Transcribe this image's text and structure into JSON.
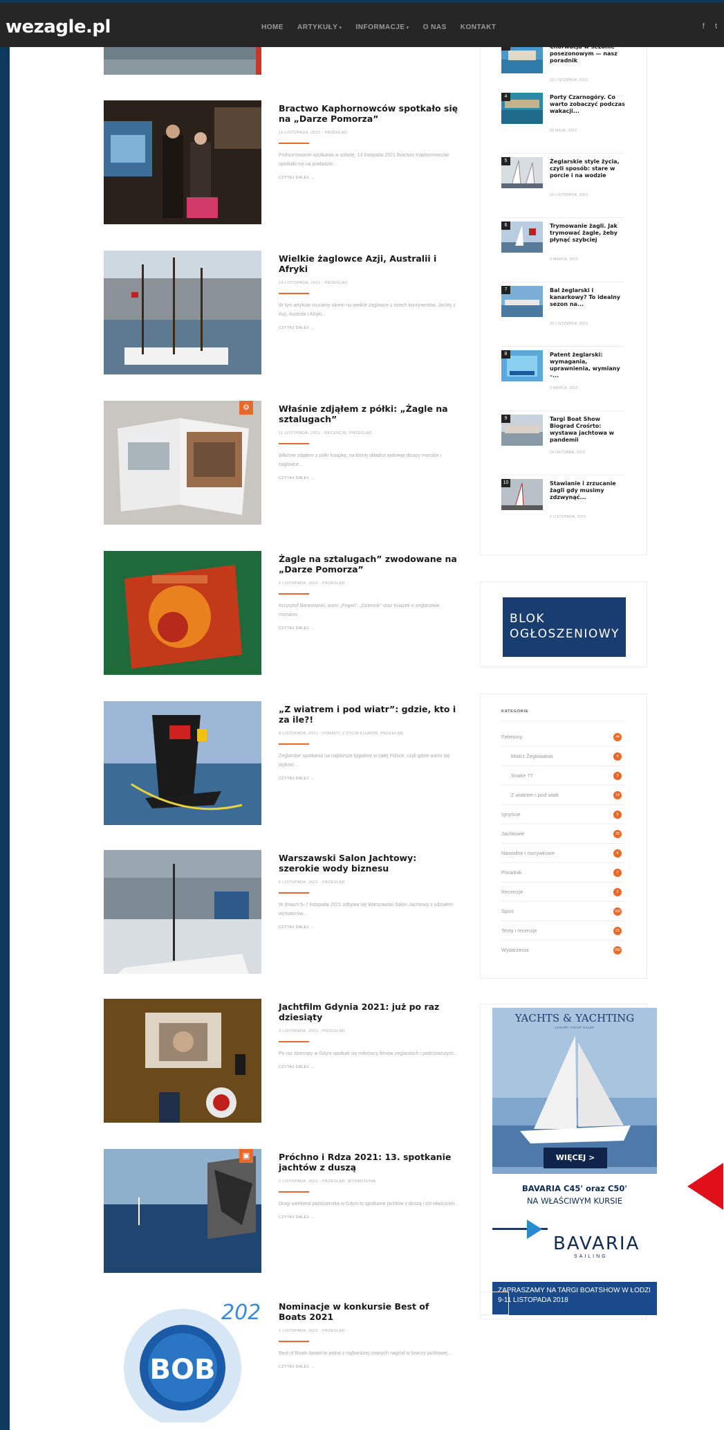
{
  "header": {
    "logo": "wezagle.pl",
    "nav": [
      {
        "label": "HOME",
        "active": true,
        "dropdown": false
      },
      {
        "label": "ARTYKUŁY",
        "active": false,
        "dropdown": true
      },
      {
        "label": "INFORMACJE",
        "active": false,
        "dropdown": true
      },
      {
        "label": "O NAS",
        "active": false,
        "dropdown": false
      },
      {
        "label": "KONTAKT",
        "active": false,
        "dropdown": false
      }
    ],
    "social": "f  t"
  },
  "posts": [
    {
      "title": "Bractwo Kaphornowców spotkało się na „Darze Pomorza”",
      "meta": "16 LISTOPADA, 2021  -  PRZEGLĄD",
      "excerpt": "Podsumowanie spotkania w sobotę, 13 listopada 2021 Bractwo Kaphornowców spotkało się na pokładzie...",
      "more": "CZYTAJ DALEJ  →"
    },
    {
      "title": "Wielkie żaglowce Azji, Australii i Afryki",
      "meta": "14 LISTOPADA, 2021  -  PRZEGLĄD",
      "excerpt": "W tym artykule rzucamy okiem na wielkie żaglowce z trzech kontynentów. Jachty z Azji, Australii i Afryki...",
      "more": "CZYTAJ DALEJ  →"
    },
    {
      "title": "Właśnie zdjąłem z półki: „Żagle na sztalugach”",
      "meta": "11 LISTOPADA, 2021  -  RECENZJE, PRZEGLĄD",
      "excerpt": "Właśnie zdjąłem z półki książkę, na której okładce widnieją obrazy morskie i żaglowce...",
      "more": "CZYTAJ DALEJ  →"
    },
    {
      "title": "Żagle na sztalugach” zwodowane na „Darze Pomorza”",
      "meta": "9 LISTOPADA, 2021  -  PRZEGLĄD",
      "excerpt": "Krzysztof Baranowski, autor „Pogoń”, „Dziennik” oraz książek o żeglarstwie morskim...",
      "more": "CZYTAJ DALEJ  →"
    },
    {
      "title": "„Z wiatrem i pod wiatr”: gdzie, kto i za ile?!",
      "meta": "8 LISTOPADA, 2021  -  PORADY, Z ŻYCIA KLUBÓW, PRZEGLĄD",
      "excerpt": "Żeglarskie spotkania na najbliższe tygodnie w całej Polsce, czyli gdzie warto się wybrać...",
      "more": "CZYTAJ DALEJ  →"
    },
    {
      "title": "Warszawski Salon Jachtowy: szerokie wody biznesu",
      "meta": "5 LISTOPADA, 2021  -  PRZEGLĄD",
      "excerpt": "W dniach 5–7 listopada 2021 odbywa się Warszawski Salon Jachtowy z udziałem wystawców...",
      "more": "CZYTAJ DALEJ  →"
    },
    {
      "title": "Jachtfilm Gdynia 2021: już po raz dziesiąty",
      "meta": "3 LISTOPADA, 2021  -  PRZEGLĄD",
      "excerpt": "Po raz dziesiąty w Gdyni spotkali się miłośnicy filmów żeglarskich i podróżniczych...",
      "more": "CZYTAJ DALEJ  →"
    },
    {
      "title": "Próchno i Rdza 2021: 13. spotkanie jachtów z duszą",
      "meta": "2 LISTOPADA, 2021  -  PRZEGLĄD, WYDARZENIA",
      "excerpt": "Drugi weekend października w Gdyni to spotkanie jachtów z duszą i ich właścicieli...",
      "more": "CZYTAJ DALEJ  →"
    },
    {
      "title": "Nominacje w konkursie Best of Boats 2021",
      "meta": "1 LISTOPADA, 2021  -  PRZEGLĄD",
      "excerpt": "Best of Boats Award to jedna z najbardziej znanych nagród w branży jachtowej...",
      "more": "CZYTAJ DALEJ  →"
    }
  ],
  "popular": [
    {
      "num": "3",
      "title": "Chorwacja w sezonie posezonowym — nasz poradnik",
      "date": "10 LISTOPADA, 2021"
    },
    {
      "num": "4",
      "title": "Porty Czarnogóry. Co warto zobaczyć podczas wakacji...",
      "date": "28 MAJA, 2021"
    },
    {
      "num": "5",
      "title": "Żeglarskie style życia, czyli sposób: stare w porcie i na wodzie",
      "date": "12 LISTOPADA, 2021"
    },
    {
      "num": "6",
      "title": "Trymowanie żagli. Jak trymować żagle, żeby płynąć szybciej",
      "date": "3 MARCA, 2021"
    },
    {
      "num": "7",
      "title": "Bal żeglarski i kanarkowy? To idealny sezon na...",
      "date": "20 LISTOPADA, 2021"
    },
    {
      "num": "8",
      "title": "Patent żeglarski: wymagania, uprawnienia, wymiany –...",
      "date": "3 MARCA, 2021"
    },
    {
      "num": "9",
      "title": "Targi Boat Show Biograd Crośrto: wystawa jachtowa w pandemii",
      "date": "24 OKTOBRA, 2021"
    },
    {
      "num": "10",
      "title": "Stawianie i zrzucanie żagli gdy musimy zdzwynąć...",
      "date": "2 LISTOPADA, 2021"
    }
  ],
  "ad_block": {
    "line1": "BLOK",
    "line2": "OGŁOSZENIOWY"
  },
  "categories": {
    "title": "KATEGORIE",
    "items": [
      {
        "label": "Felietony",
        "count": "44",
        "indent": false
      },
      {
        "label": "Mistrz Żeglowania",
        "count": "4",
        "indent": true
      },
      {
        "label": "Snake 77",
        "count": "3",
        "indent": true
      },
      {
        "label": "Z wiatrem i pod wiatr",
        "count": "14",
        "indent": true
      },
      {
        "label": "Ignyście",
        "count": "5",
        "indent": false
      },
      {
        "label": "Jachtowie",
        "count": "29",
        "indent": false
      },
      {
        "label": "Nawodne i rozrywkowe",
        "count": "8",
        "indent": false
      },
      {
        "label": "Poradnik",
        "count": "7",
        "indent": false
      },
      {
        "label": "Recenzje",
        "count": "2",
        "indent": false
      },
      {
        "label": "Sport",
        "count": "103",
        "indent": false
      },
      {
        "label": "Testy i recenzje",
        "count": "15",
        "indent": false
      },
      {
        "label": "Wydarzenia",
        "count": "250",
        "indent": false
      }
    ]
  },
  "yacht_ad": {
    "brand_top": "YACHTS & YACHTING",
    "brand_sub": "LUXURY YACHT SALES",
    "button": "WIĘCEJ >",
    "line1": "BAVARIA C45' oraz C50'",
    "line2": "NA WŁAŚCIWYM KURSIE",
    "brand": "BAVARIA",
    "brand_small": "SAILING",
    "footer1": "ZAPRASZAMY NA TARGI BOATSHOW W ŁODZI",
    "footer2": "9-11 LISTOPADA 2018"
  },
  "colors": {
    "accent": "#e8692a",
    "header_bg": "#262626",
    "frame": "#0d3a5c",
    "ad_blue": "#183d6e"
  }
}
